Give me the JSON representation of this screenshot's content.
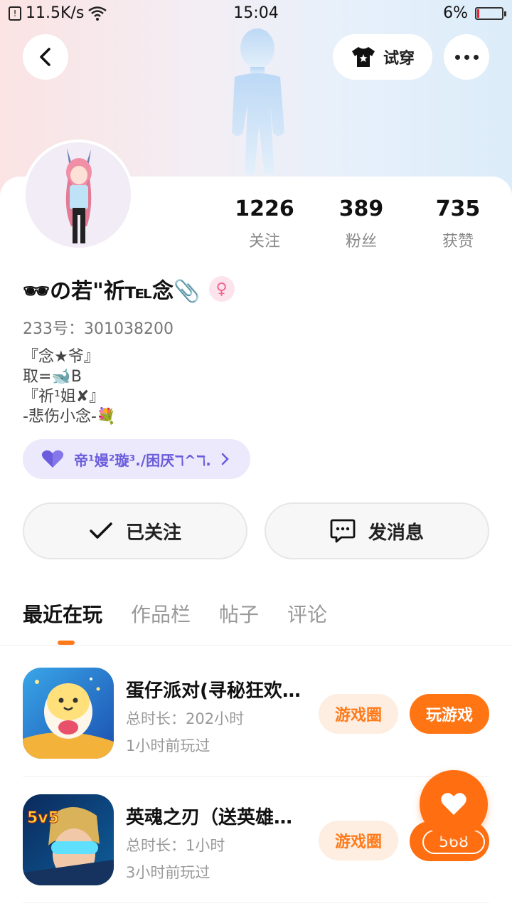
{
  "status_bar": {
    "network_speed": "11.5K/s",
    "time": "15:04",
    "battery": "6%"
  },
  "header": {
    "tryon_label": "试穿"
  },
  "profile": {
    "nickname": "🕶の若\"祈℡念📎",
    "gender_symbol": "♀",
    "uid": "233号：301038200",
    "bio": [
      "『念★爷』",
      "取=🐋B",
      "『祈¹姐✘』",
      "-悲伤小念-💐"
    ],
    "guild": "帝¹嫚²璇³./困厌ℸ^ℸ."
  },
  "stats": [
    {
      "value": "1226",
      "label": "关注"
    },
    {
      "value": "389",
      "label": "粉丝"
    },
    {
      "value": "735",
      "label": "获赞"
    }
  ],
  "actions": {
    "follow_label": "已关注",
    "message_label": "发消息"
  },
  "tabs": [
    {
      "label": "最近在玩",
      "active": true
    },
    {
      "label": "作品栏",
      "active": false
    },
    {
      "label": "帖子",
      "active": false
    },
    {
      "label": "评论",
      "active": false
    }
  ],
  "games": [
    {
      "title": "蛋仔派对(寻秘狂欢…",
      "duration": "总时长：202小时",
      "last_played": "1小时前玩过",
      "circle_label": "游戏圈",
      "play_label": "玩游戏"
    },
    {
      "title": "英魂之刃（送英雄…",
      "duration": "总时长：1小时",
      "last_played": "3小时前玩过",
      "circle_label": "游戏圈",
      "play_label": ""
    }
  ],
  "like_fab": {
    "count": "568"
  },
  "colors": {
    "accent": "#ff7413",
    "guild": "#6a5cdc",
    "gender": "#f0648f"
  }
}
